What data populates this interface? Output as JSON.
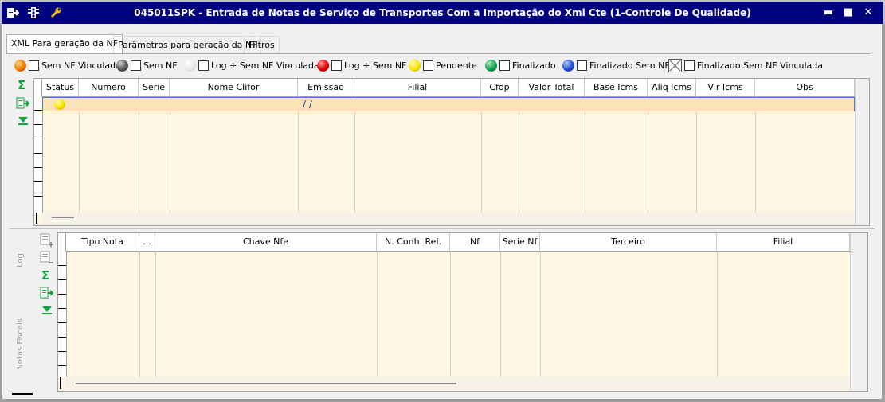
{
  "window": {
    "title": "045011SPK - Entrada de Notas de Serviço de Transportes Com a Importação do Xml Cte (1-Controle De Qualidade)",
    "controls": [
      "▬",
      "■",
      "✕"
    ]
  },
  "tabs": [
    {
      "label": "XML Para geração da NF",
      "active": true
    },
    {
      "label": "Parâmetros para geração da NF",
      "active": false
    },
    {
      "label": "Filtros",
      "active": false
    }
  ],
  "legend": [
    {
      "label": "Sem NF Vinculada",
      "color": "#f07a00"
    },
    {
      "label": "Sem NF",
      "color": "#555555"
    },
    {
      "label": "Log + Sem NF Vinculada",
      "color": "#e8e8e8"
    },
    {
      "label": "Log + Sem NF",
      "color": "#e00000"
    },
    {
      "label": "Pendente",
      "color": "#f5e600"
    },
    {
      "label": "Finalizado",
      "color": "#10a050"
    },
    {
      "label": "Finalizado Sem NF",
      "color": "#2050d8"
    },
    {
      "label": "Finalizado Sem NF Vinculada",
      "color": "none"
    }
  ],
  "top_grid": {
    "columns": [
      "Status",
      "Numero",
      "Serie",
      "Nome Clifor",
      "Emissao",
      "Filial",
      "Cfop",
      "Valor Total",
      "Base Icms",
      "Aliq Icms",
      "Vlr Icms",
      "Obs"
    ],
    "row": {
      "status_color": "#f5e600",
      "emissao": "/ /"
    }
  },
  "side_tabs": [
    "Log",
    "Notas Fiscais"
  ],
  "bottom_grid": {
    "columns": [
      "Tipo Nota",
      "...",
      "Chave Nfe",
      "N. Conh. Rel.",
      "Nf",
      "Serie Nf",
      "Terceiro",
      "Filial"
    ]
  }
}
